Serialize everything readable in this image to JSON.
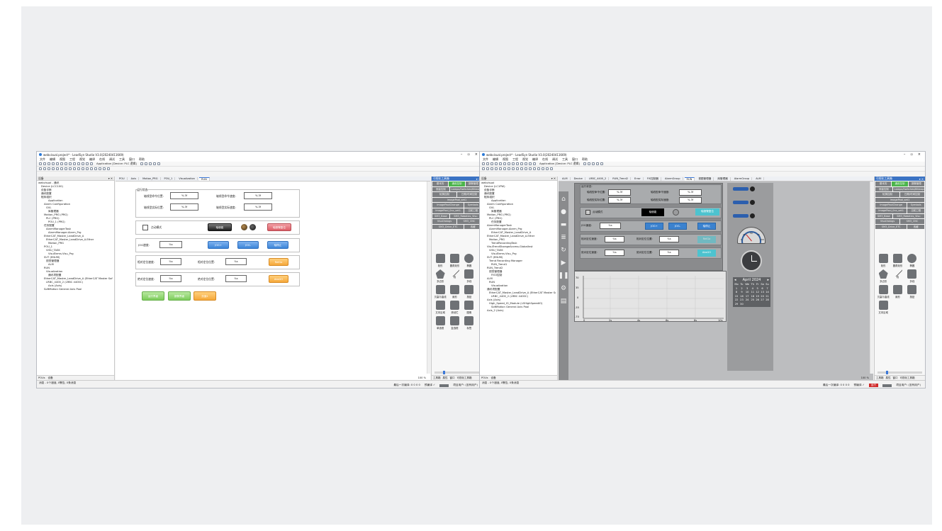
{
  "windows": [
    {
      "title": "webvisual.project* - LeadSyn Studio V3.0(20240411669)",
      "menus": [
        "文件",
        "编辑",
        "视图",
        "工程",
        "视觉",
        "编译",
        "在线",
        "调试",
        "工具",
        "窗口",
        "帮助"
      ],
      "config_label": "Application [Device: PLC 逻辑]",
      "device_pane_title": "设备",
      "tree": [
        "webvisual - 通讯",
        "Device (LCC100)",
        "设备诊断",
        "通讯配置",
        "程序组织",
        "Application",
        "Alarm Configuration",
        "GVL",
        "库管理器",
        "Motion_PRG (PRG)",
        "PLC (PRG)",
        "POU_1 (PRG)",
        "任务配置",
        "AlarmManagerTask",
        "AlarmManager.Alarm_Prg",
        "EtherCAT_Master_LeadDrive_A",
        "EtherCAT_Master_LeadDrive_A.Ether",
        "Motion_PRG",
        "POU_1",
        "VISU_TASK",
        "VisuElems.Visu_Prg",
        "SUT (ENUM)",
        "视觉管理器",
        "ALM",
        "RUN",
        "Visualization",
        "通讯项配置",
        "EtherCAT_Master_LeadDrive_A (EtherCAT Master Sof",
        "LRBC_4400_2 (LRBC 4400C)",
        "Axis (Axis)",
        "SoftMotion General Axis Pool"
      ],
      "doc_tabs": [
        "POU",
        "Axis",
        "Motion_PRG",
        "POU_1",
        "Visualization",
        "RUN"
      ],
      "pane_tabs": [
        "POUs",
        "设备"
      ],
      "form": {
        "group_title": "运行状态:",
        "pos_label": "轴线型命令位置:",
        "pos_value": "%.3f",
        "speed_label": "轴线型命令速度:",
        "speed_value": "%.3f",
        "actpos_label": "轴线型实际位置:",
        "actpos_value": "%.3f",
        "actspeed_label": "轴线型实际速度:",
        "actspeed_value": "%.3f",
        "mode_label": "点动模式",
        "enable_label": "轴使能",
        "reset_label": "轴报警复位",
        "jog_label": "JOG速度:",
        "jog_value": "%s",
        "jog_plus": "JOG+",
        "jog_minus": "JOG-",
        "stop_label": "轴停止",
        "rel_speed_label": "相对定位速度:",
        "rel_speed_value": "%s",
        "rel_pos_label": "相对定位位置:",
        "rel_pos_value": "%s",
        "rel_go": "RelGo",
        "abs_speed_label": "绝对定位速度:",
        "abs_speed_value": "%s",
        "abs_pos_label": "绝对定位位置:",
        "abs_pos_value": "%s",
        "abs_go": "AbsGO",
        "bottom_buttons": [
          "运行界面",
          "报警界面",
          "页面1"
        ]
      },
      "zoom": "100 %",
      "status_left": "消息 - 0个错误, 0警告, 0条消息",
      "status_right": [
        "最后一次编译: 0 0 0 0",
        "预编译 ✓",
        "项目用户: (没有用户)"
      ]
    },
    {
      "title": "webvisual.project* - LeadSyn Studio V3.0(20240411669)",
      "config_label": "Application [Device: PLC 逻辑]",
      "tree": [
        "webvisual",
        "Device (LC1PW)",
        "设备诊断",
        "通讯配置",
        "程序组织",
        "Application",
        "Alarm Configuration",
        "GVL",
        "库管理器",
        "Motion_PRG (PRG)",
        "PLC (PRG)",
        "任务配置",
        "AlarmManagerTask",
        "AlarmManager.Alarm_Prg",
        "EtherCAT_Master_LeadDrive_A",
        "EtherCAT_Master_LeadDrive_A.Ether",
        "Motion_PRG",
        "TrendRecordingTask",
        "VisuTrendStorageAccess.GlobalInst",
        "VISU_TASK",
        "VisuElems.Visu_Prg",
        "SUT (ENUM)",
        "Trend Recording Manager",
        "RUN_Trend1",
        "RUN_Trend2",
        "视觉管理器",
        "FIS3控制",
        "ALM",
        "RUN",
        "Visualization",
        "通讯项配置",
        "EtherCAT_Master_LeadDrive_A (EtherCAT Master Sof",
        "LRBC_4400_2 (LRBC 4400C)",
        "Axis (Axis)",
        "High_Speed_IO_Module (LSHighSpeedIO)",
        "SoftMotion General Axis Pool",
        "Axis_2 (Axis)"
      ],
      "doc_tabs": [
        "ALM",
        "Device",
        "LRBC_4400_2",
        "RUN_Trend2",
        "Error",
        "FIS控制器",
        "AlarmGroup",
        "RUN",
        "视图管理器",
        "库管理器",
        "AlarmGroup",
        "ALM"
      ],
      "form": {
        "group_title": "运行状态:",
        "pos_label": "轴线型命令位置:",
        "pos_value": "%.3f",
        "speed_label": "轴线型命令速度:",
        "speed_value": "%.3f",
        "actpos_label": "轴线型实际位置:",
        "actpos_value": "%.3f",
        "actspeed_label": "轴线型实际速度:",
        "actspeed_value": "%.3f",
        "mode_label": "点动模式",
        "enable_label": "轴使能",
        "reset_label": "轴报警复位",
        "jog_label": "JOG速度:",
        "jog_value": "%s",
        "jog_plus": "JOG+",
        "jog_minus": "JOG-",
        "stop_label": "轴停止",
        "rel_speed_label": "相对定位速度:",
        "rel_speed_value": "%s",
        "rel_pos_label": "相对定位位置:",
        "rel_pos_value": "%s",
        "rel_go": "RelGo",
        "abs_speed_label": "绝对定位速度:",
        "abs_speed_value": "%s",
        "abs_pos_label": "绝对定位位置:",
        "abs_pos_value": "%s",
        "abs_go": "AbsGO"
      },
      "trend_y_ticks": [
        "70",
        "35",
        "0",
        "-35",
        "-70"
      ],
      "trend_x_ticks": [
        "0",
        "2s",
        "4s",
        "6s",
        "8s",
        "10s"
      ],
      "calendar": {
        "month": "April",
        "year": "2024",
        "weekdays": [
          "Mo",
          "Tu",
          "We",
          "Th",
          "Fr",
          "Sa",
          "Su"
        ],
        "weeks": [
          [
            "1",
            "2",
            "3",
            "4",
            "5",
            "6",
            "7"
          ],
          [
            "8",
            "9",
            "10",
            "11",
            "12",
            "13",
            "14"
          ],
          [
            "15",
            "16",
            "17",
            "18",
            "19",
            "20",
            "21"
          ],
          [
            "22",
            "23",
            "24",
            "25",
            "26",
            "27",
            "28"
          ],
          [
            "29",
            "30",
            "",
            "",
            "",
            "",
            ""
          ]
        ]
      },
      "gauge_ticks": [
        "0",
        "25",
        "50",
        "75",
        "100"
      ],
      "zoom": "100 %",
      "status_left": "消息 - 0个错误, 0警告, 0条消息",
      "status_right": [
        "最后一次编译: 0 0 0 0",
        "预编译 ✓",
        "运行",
        "项目用户: (没有用户)"
      ]
    }
  ],
  "toolbox": {
    "title": "可视化工具箱",
    "buttons": [
      "基本的",
      "通用控制",
      "报警管理",
      "测量控制",
      "Lamps/Switches/Bitmaps",
      "轮换控制",
      "日期/时间控制",
      "ImagePool_set1",
      "ImagePoolChange",
      "Symbols",
      "ImagePool_0nc_set1",
      "当前工程",
      "SM3_Base",
      "SM3_Robotics_Visu",
      "VisuDialogs",
      "SM3_CNC",
      "SM3_Drive_ETC",
      "收藏"
    ],
    "highlight": "通用控制",
    "controls": [
      "矩形",
      "圆角矩形",
      "椭圆",
      "多边形",
      "线",
      "折线",
      "贝塞尔曲线",
      "扇形",
      "按钮",
      "文本区域",
      "滚动栏",
      "图像",
      "单选框",
      "复选框",
      "标签",
      "组框",
      "表格"
    ],
    "pane_tabs": [
      "工具箱",
      "属性",
      "窗口",
      "可视化工具箱"
    ]
  },
  "colors": {
    "accent": "#3b73c4",
    "highlight_green": "#4bb54b",
    "palette_gray": "#7d7f82",
    "runtime_bg": "#bcbdbf",
    "status_red": "#d02828"
  }
}
